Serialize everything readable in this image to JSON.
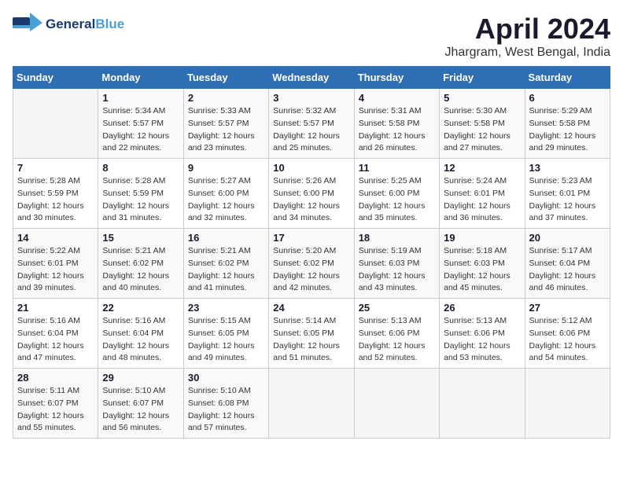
{
  "header": {
    "logo_line1": "General",
    "logo_line2": "Blue",
    "month_title": "April 2024",
    "location": "Jhargram, West Bengal, India"
  },
  "days_of_week": [
    "Sunday",
    "Monday",
    "Tuesday",
    "Wednesday",
    "Thursday",
    "Friday",
    "Saturday"
  ],
  "weeks": [
    [
      {
        "day": "",
        "empty": true
      },
      {
        "day": "1",
        "sunrise": "Sunrise: 5:34 AM",
        "sunset": "Sunset: 5:57 PM",
        "daylight": "Daylight: 12 hours and 22 minutes."
      },
      {
        "day": "2",
        "sunrise": "Sunrise: 5:33 AM",
        "sunset": "Sunset: 5:57 PM",
        "daylight": "Daylight: 12 hours and 23 minutes."
      },
      {
        "day": "3",
        "sunrise": "Sunrise: 5:32 AM",
        "sunset": "Sunset: 5:57 PM",
        "daylight": "Daylight: 12 hours and 25 minutes."
      },
      {
        "day": "4",
        "sunrise": "Sunrise: 5:31 AM",
        "sunset": "Sunset: 5:58 PM",
        "daylight": "Daylight: 12 hours and 26 minutes."
      },
      {
        "day": "5",
        "sunrise": "Sunrise: 5:30 AM",
        "sunset": "Sunset: 5:58 PM",
        "daylight": "Daylight: 12 hours and 27 minutes."
      },
      {
        "day": "6",
        "sunrise": "Sunrise: 5:29 AM",
        "sunset": "Sunset: 5:58 PM",
        "daylight": "Daylight: 12 hours and 29 minutes."
      }
    ],
    [
      {
        "day": "7",
        "sunrise": "Sunrise: 5:28 AM",
        "sunset": "Sunset: 5:59 PM",
        "daylight": "Daylight: 12 hours and 30 minutes."
      },
      {
        "day": "8",
        "sunrise": "Sunrise: 5:28 AM",
        "sunset": "Sunset: 5:59 PM",
        "daylight": "Daylight: 12 hours and 31 minutes."
      },
      {
        "day": "9",
        "sunrise": "Sunrise: 5:27 AM",
        "sunset": "Sunset: 6:00 PM",
        "daylight": "Daylight: 12 hours and 32 minutes."
      },
      {
        "day": "10",
        "sunrise": "Sunrise: 5:26 AM",
        "sunset": "Sunset: 6:00 PM",
        "daylight": "Daylight: 12 hours and 34 minutes."
      },
      {
        "day": "11",
        "sunrise": "Sunrise: 5:25 AM",
        "sunset": "Sunset: 6:00 PM",
        "daylight": "Daylight: 12 hours and 35 minutes."
      },
      {
        "day": "12",
        "sunrise": "Sunrise: 5:24 AM",
        "sunset": "Sunset: 6:01 PM",
        "daylight": "Daylight: 12 hours and 36 minutes."
      },
      {
        "day": "13",
        "sunrise": "Sunrise: 5:23 AM",
        "sunset": "Sunset: 6:01 PM",
        "daylight": "Daylight: 12 hours and 37 minutes."
      }
    ],
    [
      {
        "day": "14",
        "sunrise": "Sunrise: 5:22 AM",
        "sunset": "Sunset: 6:01 PM",
        "daylight": "Daylight: 12 hours and 39 minutes."
      },
      {
        "day": "15",
        "sunrise": "Sunrise: 5:21 AM",
        "sunset": "Sunset: 6:02 PM",
        "daylight": "Daylight: 12 hours and 40 minutes."
      },
      {
        "day": "16",
        "sunrise": "Sunrise: 5:21 AM",
        "sunset": "Sunset: 6:02 PM",
        "daylight": "Daylight: 12 hours and 41 minutes."
      },
      {
        "day": "17",
        "sunrise": "Sunrise: 5:20 AM",
        "sunset": "Sunset: 6:02 PM",
        "daylight": "Daylight: 12 hours and 42 minutes."
      },
      {
        "day": "18",
        "sunrise": "Sunrise: 5:19 AM",
        "sunset": "Sunset: 6:03 PM",
        "daylight": "Daylight: 12 hours and 43 minutes."
      },
      {
        "day": "19",
        "sunrise": "Sunrise: 5:18 AM",
        "sunset": "Sunset: 6:03 PM",
        "daylight": "Daylight: 12 hours and 45 minutes."
      },
      {
        "day": "20",
        "sunrise": "Sunrise: 5:17 AM",
        "sunset": "Sunset: 6:04 PM",
        "daylight": "Daylight: 12 hours and 46 minutes."
      }
    ],
    [
      {
        "day": "21",
        "sunrise": "Sunrise: 5:16 AM",
        "sunset": "Sunset: 6:04 PM",
        "daylight": "Daylight: 12 hours and 47 minutes."
      },
      {
        "day": "22",
        "sunrise": "Sunrise: 5:16 AM",
        "sunset": "Sunset: 6:04 PM",
        "daylight": "Daylight: 12 hours and 48 minutes."
      },
      {
        "day": "23",
        "sunrise": "Sunrise: 5:15 AM",
        "sunset": "Sunset: 6:05 PM",
        "daylight": "Daylight: 12 hours and 49 minutes."
      },
      {
        "day": "24",
        "sunrise": "Sunrise: 5:14 AM",
        "sunset": "Sunset: 6:05 PM",
        "daylight": "Daylight: 12 hours and 51 minutes."
      },
      {
        "day": "25",
        "sunrise": "Sunrise: 5:13 AM",
        "sunset": "Sunset: 6:06 PM",
        "daylight": "Daylight: 12 hours and 52 minutes."
      },
      {
        "day": "26",
        "sunrise": "Sunrise: 5:13 AM",
        "sunset": "Sunset: 6:06 PM",
        "daylight": "Daylight: 12 hours and 53 minutes."
      },
      {
        "day": "27",
        "sunrise": "Sunrise: 5:12 AM",
        "sunset": "Sunset: 6:06 PM",
        "daylight": "Daylight: 12 hours and 54 minutes."
      }
    ],
    [
      {
        "day": "28",
        "sunrise": "Sunrise: 5:11 AM",
        "sunset": "Sunset: 6:07 PM",
        "daylight": "Daylight: 12 hours and 55 minutes."
      },
      {
        "day": "29",
        "sunrise": "Sunrise: 5:10 AM",
        "sunset": "Sunset: 6:07 PM",
        "daylight": "Daylight: 12 hours and 56 minutes."
      },
      {
        "day": "30",
        "sunrise": "Sunrise: 5:10 AM",
        "sunset": "Sunset: 6:08 PM",
        "daylight": "Daylight: 12 hours and 57 minutes."
      },
      {
        "day": "",
        "empty": true
      },
      {
        "day": "",
        "empty": true
      },
      {
        "day": "",
        "empty": true
      },
      {
        "day": "",
        "empty": true
      }
    ]
  ]
}
